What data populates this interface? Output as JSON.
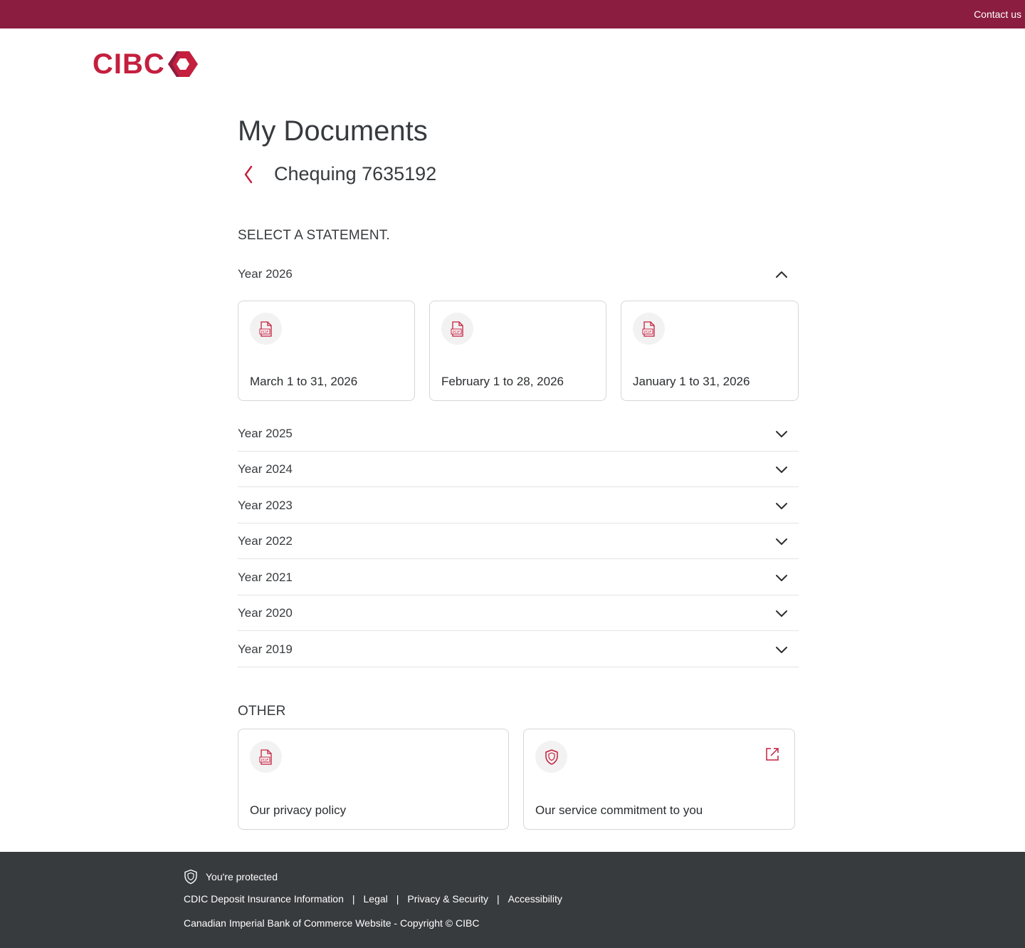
{
  "header": {
    "contact_label": "Contact us",
    "brand_color": "#8b1d41"
  },
  "logo": {
    "text": "CIBC",
    "color": "#c41f3e"
  },
  "page": {
    "title": "My Documents",
    "account_title": "Chequing 7635192"
  },
  "statements": {
    "heading": "SELECT A STATEMENT.",
    "expanded_year": {
      "label": "Year 2026",
      "documents": [
        {
          "label": "March 1 to 31, 2026",
          "icon": "pdf-icon"
        },
        {
          "label": "February 1 to 28, 2026",
          "icon": "pdf-icon"
        },
        {
          "label": "January 1 to 31, 2026",
          "icon": "pdf-icon"
        }
      ]
    },
    "collapsed_years": [
      "Year 2025",
      "Year 2024",
      "Year 2023",
      "Year 2022",
      "Year 2021",
      "Year 2020",
      "Year 2019"
    ]
  },
  "other": {
    "heading": "OTHER",
    "items": [
      {
        "label": "Our privacy policy",
        "icon": "pdf-icon"
      },
      {
        "label": "Our service commitment to you",
        "icon": "shield-icon",
        "external": true
      }
    ]
  },
  "footer": {
    "protected_label": "You're protected",
    "links": [
      "CDIC Deposit Insurance Information",
      "Legal",
      "Privacy & Security",
      "Accessibility"
    ],
    "copyright": "Canadian Imperial Bank of Commerce Website - Copyright © CIBC",
    "background": "#383b3e"
  }
}
